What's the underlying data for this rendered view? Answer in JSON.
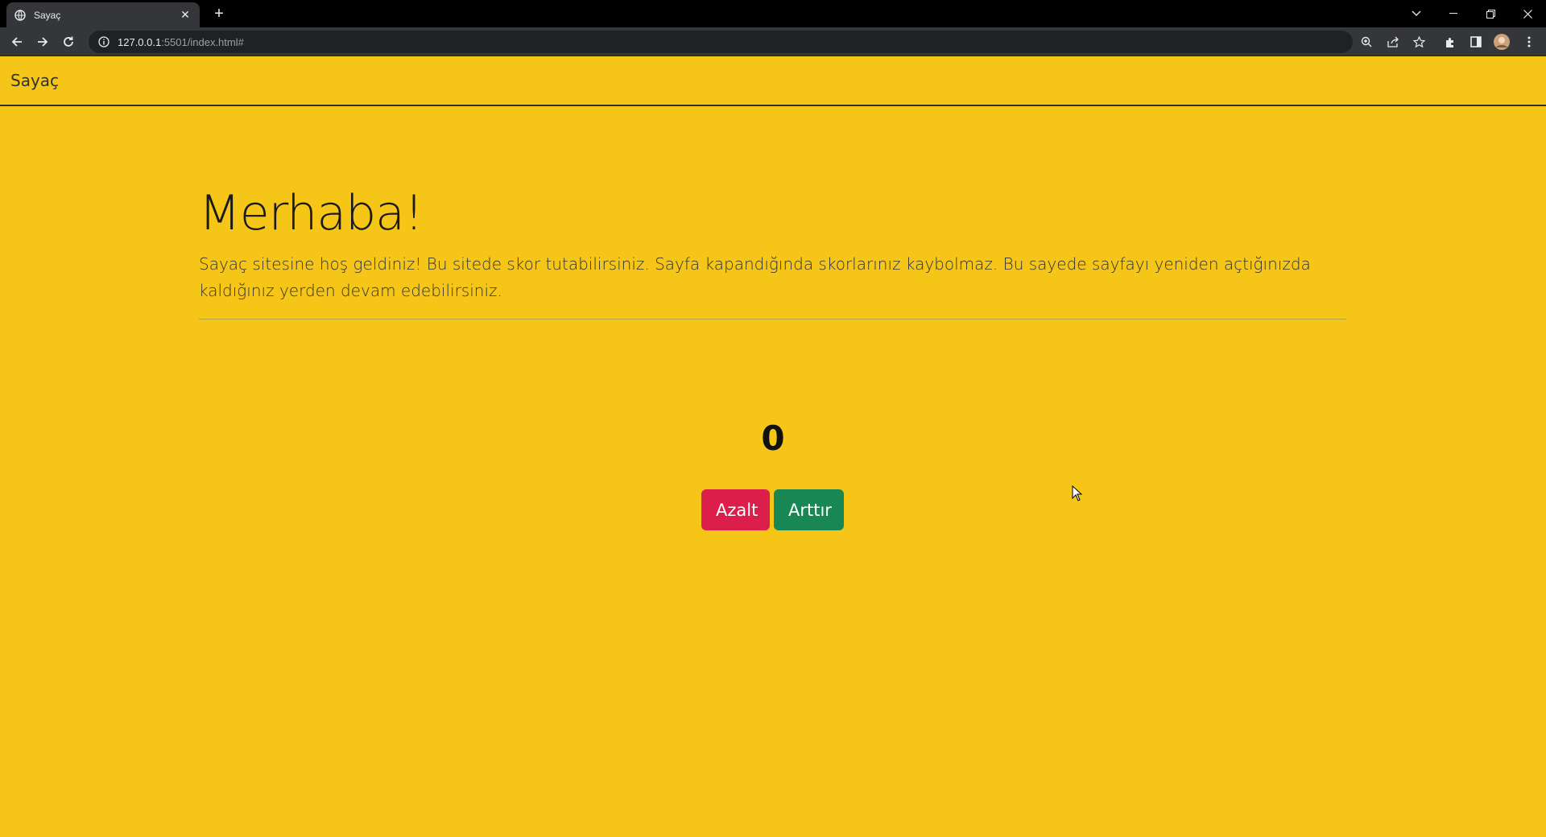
{
  "browser": {
    "tab_title": "Sayaç",
    "new_tab": "+",
    "url_host": "127.0.0.1",
    "url_path": ":5501/index.html#"
  },
  "page": {
    "brand": "Sayaç",
    "heading": "Merhaba!",
    "lead": "Sayaç sitesine hoş geldiniz! Bu sitede skor tutabilirsiniz. Sayfa kapandığında skorlarınız kaybolmaz. Bu sayede sayfayı yeniden açtığınızda kaldığınız yerden devam edebilirsiniz.",
    "counter_value": "0",
    "decrease_label": "Azalt",
    "increase_label": "Arttır"
  },
  "colors": {
    "page_background": "#f5c518",
    "decrease_button": "#dc1f4a",
    "increase_button": "#198754"
  }
}
